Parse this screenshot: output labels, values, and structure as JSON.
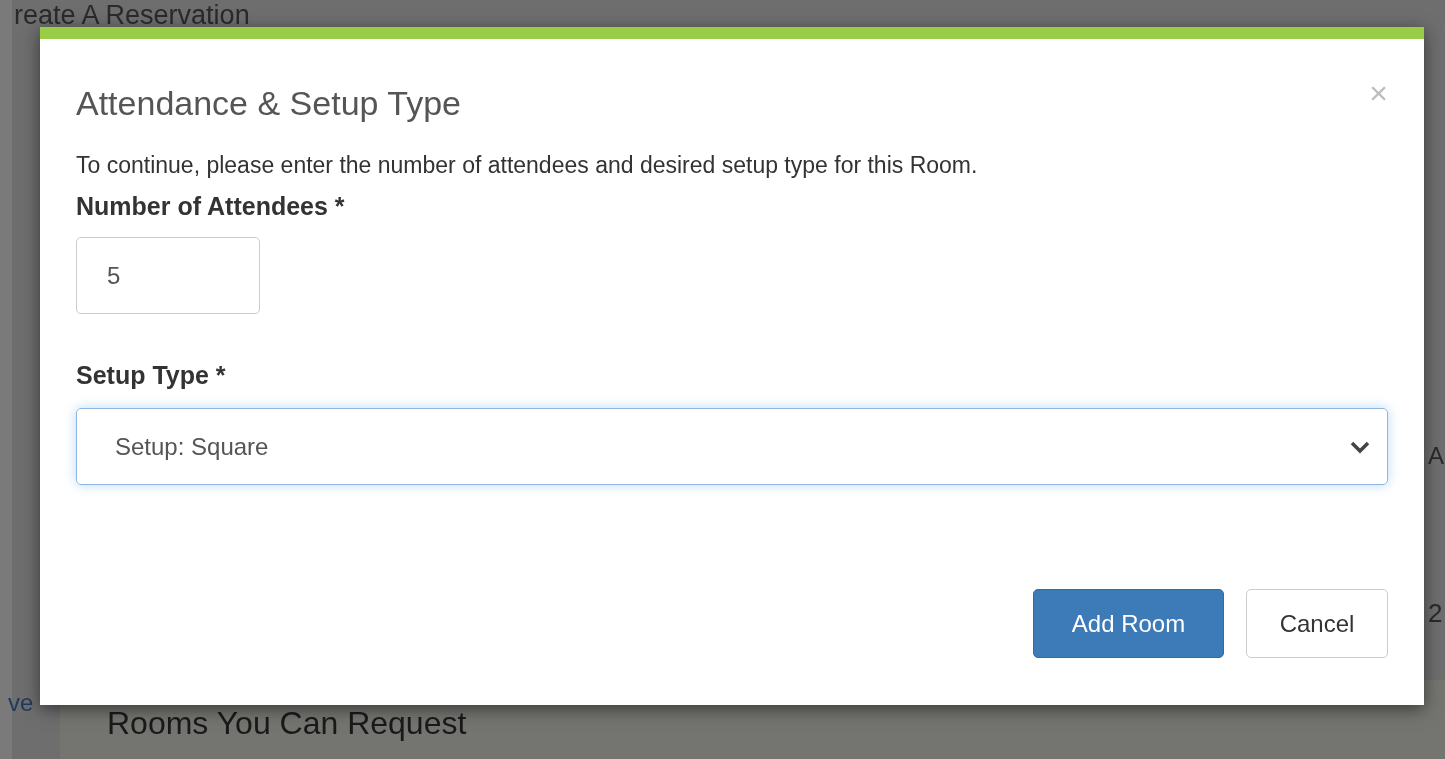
{
  "background_page": {
    "title": "reate A Reservation",
    "side_link": "ve",
    "column_fragment": "A",
    "cell_fragment": "2",
    "section_heading": "Rooms You Can Request"
  },
  "dialog": {
    "title": "Attendance & Setup Type",
    "close": "×",
    "description": "To continue, please enter the number of attendees and desired setup type for this Room.",
    "fields": [
      {
        "kind": "number",
        "label": "Number of Attendees *",
        "value": "5"
      },
      {
        "kind": "select",
        "label": "Setup Type *",
        "value": "Setup: Square",
        "focused": true
      }
    ],
    "buttons": [
      {
        "label": "Add Room",
        "primary": true
      },
      {
        "label": "Cancel",
        "primary": false
      }
    ]
  }
}
